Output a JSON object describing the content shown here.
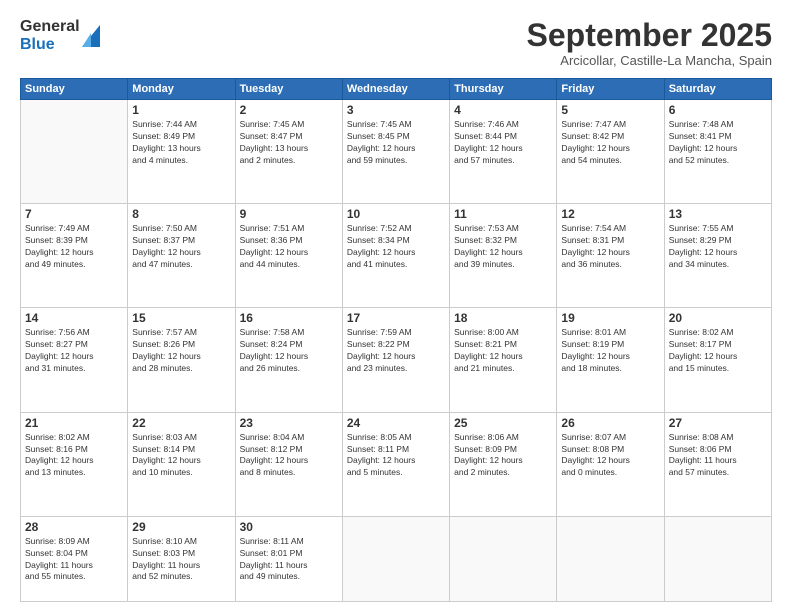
{
  "logo": {
    "general": "General",
    "blue": "Blue"
  },
  "title": "September 2025",
  "subtitle": "Arcicollar, Castille-La Mancha, Spain",
  "weekdays": [
    "Sunday",
    "Monday",
    "Tuesday",
    "Wednesday",
    "Thursday",
    "Friday",
    "Saturday"
  ],
  "weeks": [
    [
      {
        "day": "",
        "info": ""
      },
      {
        "day": "1",
        "info": "Sunrise: 7:44 AM\nSunset: 8:49 PM\nDaylight: 13 hours\nand 4 minutes."
      },
      {
        "day": "2",
        "info": "Sunrise: 7:45 AM\nSunset: 8:47 PM\nDaylight: 13 hours\nand 2 minutes."
      },
      {
        "day": "3",
        "info": "Sunrise: 7:45 AM\nSunset: 8:45 PM\nDaylight: 12 hours\nand 59 minutes."
      },
      {
        "day": "4",
        "info": "Sunrise: 7:46 AM\nSunset: 8:44 PM\nDaylight: 12 hours\nand 57 minutes."
      },
      {
        "day": "5",
        "info": "Sunrise: 7:47 AM\nSunset: 8:42 PM\nDaylight: 12 hours\nand 54 minutes."
      },
      {
        "day": "6",
        "info": "Sunrise: 7:48 AM\nSunset: 8:41 PM\nDaylight: 12 hours\nand 52 minutes."
      }
    ],
    [
      {
        "day": "7",
        "info": "Sunrise: 7:49 AM\nSunset: 8:39 PM\nDaylight: 12 hours\nand 49 minutes."
      },
      {
        "day": "8",
        "info": "Sunrise: 7:50 AM\nSunset: 8:37 PM\nDaylight: 12 hours\nand 47 minutes."
      },
      {
        "day": "9",
        "info": "Sunrise: 7:51 AM\nSunset: 8:36 PM\nDaylight: 12 hours\nand 44 minutes."
      },
      {
        "day": "10",
        "info": "Sunrise: 7:52 AM\nSunset: 8:34 PM\nDaylight: 12 hours\nand 41 minutes."
      },
      {
        "day": "11",
        "info": "Sunrise: 7:53 AM\nSunset: 8:32 PM\nDaylight: 12 hours\nand 39 minutes."
      },
      {
        "day": "12",
        "info": "Sunrise: 7:54 AM\nSunset: 8:31 PM\nDaylight: 12 hours\nand 36 minutes."
      },
      {
        "day": "13",
        "info": "Sunrise: 7:55 AM\nSunset: 8:29 PM\nDaylight: 12 hours\nand 34 minutes."
      }
    ],
    [
      {
        "day": "14",
        "info": "Sunrise: 7:56 AM\nSunset: 8:27 PM\nDaylight: 12 hours\nand 31 minutes."
      },
      {
        "day": "15",
        "info": "Sunrise: 7:57 AM\nSunset: 8:26 PM\nDaylight: 12 hours\nand 28 minutes."
      },
      {
        "day": "16",
        "info": "Sunrise: 7:58 AM\nSunset: 8:24 PM\nDaylight: 12 hours\nand 26 minutes."
      },
      {
        "day": "17",
        "info": "Sunrise: 7:59 AM\nSunset: 8:22 PM\nDaylight: 12 hours\nand 23 minutes."
      },
      {
        "day": "18",
        "info": "Sunrise: 8:00 AM\nSunset: 8:21 PM\nDaylight: 12 hours\nand 21 minutes."
      },
      {
        "day": "19",
        "info": "Sunrise: 8:01 AM\nSunset: 8:19 PM\nDaylight: 12 hours\nand 18 minutes."
      },
      {
        "day": "20",
        "info": "Sunrise: 8:02 AM\nSunset: 8:17 PM\nDaylight: 12 hours\nand 15 minutes."
      }
    ],
    [
      {
        "day": "21",
        "info": "Sunrise: 8:02 AM\nSunset: 8:16 PM\nDaylight: 12 hours\nand 13 minutes."
      },
      {
        "day": "22",
        "info": "Sunrise: 8:03 AM\nSunset: 8:14 PM\nDaylight: 12 hours\nand 10 minutes."
      },
      {
        "day": "23",
        "info": "Sunrise: 8:04 AM\nSunset: 8:12 PM\nDaylight: 12 hours\nand 8 minutes."
      },
      {
        "day": "24",
        "info": "Sunrise: 8:05 AM\nSunset: 8:11 PM\nDaylight: 12 hours\nand 5 minutes."
      },
      {
        "day": "25",
        "info": "Sunrise: 8:06 AM\nSunset: 8:09 PM\nDaylight: 12 hours\nand 2 minutes."
      },
      {
        "day": "26",
        "info": "Sunrise: 8:07 AM\nSunset: 8:08 PM\nDaylight: 12 hours\nand 0 minutes."
      },
      {
        "day": "27",
        "info": "Sunrise: 8:08 AM\nSunset: 8:06 PM\nDaylight: 11 hours\nand 57 minutes."
      }
    ],
    [
      {
        "day": "28",
        "info": "Sunrise: 8:09 AM\nSunset: 8:04 PM\nDaylight: 11 hours\nand 55 minutes."
      },
      {
        "day": "29",
        "info": "Sunrise: 8:10 AM\nSunset: 8:03 PM\nDaylight: 11 hours\nand 52 minutes."
      },
      {
        "day": "30",
        "info": "Sunrise: 8:11 AM\nSunset: 8:01 PM\nDaylight: 11 hours\nand 49 minutes."
      },
      {
        "day": "",
        "info": ""
      },
      {
        "day": "",
        "info": ""
      },
      {
        "day": "",
        "info": ""
      },
      {
        "day": "",
        "info": ""
      }
    ]
  ]
}
